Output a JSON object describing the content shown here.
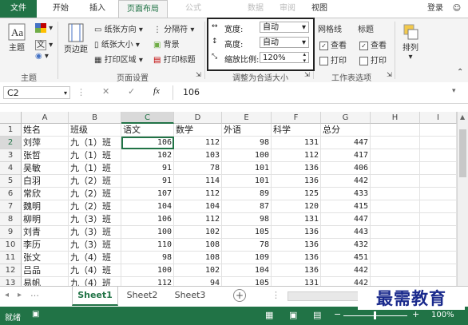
{
  "ribbon": {
    "tabs": [
      "文件",
      "开始",
      "插入",
      "页面布局",
      "公式",
      "数据",
      "审阅",
      "视图"
    ],
    "login": "登录",
    "theme_group": {
      "theme": "主题",
      "label": "主题"
    },
    "page_setup": {
      "margins": "页边距",
      "orientation": "纸张方向",
      "size": "纸张大小",
      "print_area": "打印区域",
      "breaks": "分隔符",
      "background": "背景",
      "print_titles": "打印标题",
      "label": "页面设置"
    },
    "scale_to_fit": {
      "width_label": "宽度:",
      "width_value": "自动",
      "height_label": "高度:",
      "height_value": "自动",
      "scale_label": "缩放比例:",
      "scale_value": "120%",
      "label": "调整为合适大小"
    },
    "sheet_options": {
      "gridlines": "网格线",
      "headings": "标题",
      "view": "查看",
      "print": "打印",
      "label": "工作表选项"
    },
    "arrange": "排列"
  },
  "formula_bar": {
    "name_box": "C2",
    "fx": "fx",
    "value": "106"
  },
  "grid": {
    "columns": [
      "A",
      "B",
      "C",
      "D",
      "E",
      "F",
      "G",
      "H",
      "I"
    ],
    "rows": [
      {
        "n": "1",
        "cells": [
          "姓名",
          "班级",
          "语文",
          "数学",
          "外语",
          "科学",
          "总分"
        ]
      },
      {
        "n": "2",
        "cells": [
          "刘萍",
          "九（1）班",
          "106",
          "112",
          "98",
          "131",
          "447"
        ]
      },
      {
        "n": "3",
        "cells": [
          "张哲",
          "九（1）班",
          "102",
          "103",
          "100",
          "112",
          "417"
        ]
      },
      {
        "n": "4",
        "cells": [
          "吴敏",
          "九（1）班",
          "91",
          "78",
          "101",
          "136",
          "406"
        ]
      },
      {
        "n": "5",
        "cells": [
          "白羽",
          "九（2）班",
          "91",
          "114",
          "101",
          "136",
          "442"
        ]
      },
      {
        "n": "6",
        "cells": [
          "常欣",
          "九（2）班",
          "107",
          "112",
          "89",
          "125",
          "433"
        ]
      },
      {
        "n": "7",
        "cells": [
          "魏明",
          "九（2）班",
          "104",
          "104",
          "87",
          "120",
          "415"
        ]
      },
      {
        "n": "8",
        "cells": [
          "柳明",
          "九（3）班",
          "106",
          "112",
          "98",
          "131",
          "447"
        ]
      },
      {
        "n": "9",
        "cells": [
          "刘青",
          "九（3）班",
          "100",
          "102",
          "105",
          "136",
          "443"
        ]
      },
      {
        "n": "10",
        "cells": [
          "李历",
          "九（3）班",
          "110",
          "108",
          "78",
          "136",
          "432"
        ]
      },
      {
        "n": "11",
        "cells": [
          "张文",
          "九（4）班",
          "98",
          "108",
          "109",
          "136",
          "451"
        ]
      },
      {
        "n": "12",
        "cells": [
          "吕品",
          "九（4）班",
          "100",
          "102",
          "104",
          "136",
          "442"
        ]
      },
      {
        "n": "13",
        "cells": [
          "易帆",
          "九（4）班",
          "112",
          "94",
          "105",
          "131",
          "442"
        ]
      }
    ]
  },
  "sheets": [
    "Sheet1",
    "Sheet2",
    "Sheet3"
  ],
  "status": {
    "ready": "就绪",
    "zoom": "100%"
  },
  "watermark": "最需教育",
  "colors": {
    "accent": "#217346"
  }
}
